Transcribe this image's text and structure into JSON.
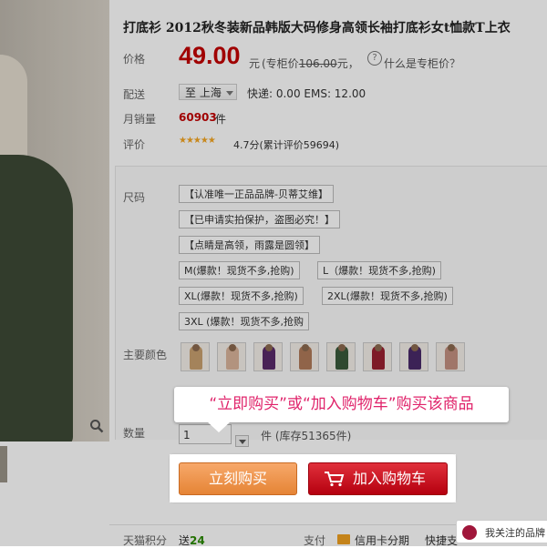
{
  "title": "打底衫 2012秋冬装新品韩版大码修身高领长袖打底衫女t恤款T上衣",
  "price": {
    "label": "价格",
    "value": "49.00",
    "unit": "元",
    "compare_prefix": "(专柜价",
    "compare_value": "106.00",
    "compare_suffix": "元，",
    "help_text": "什么是专柜价？",
    "price_color": "#c40000"
  },
  "shipping": {
    "label": "配送",
    "city": "至 上海",
    "text": "快递: 0.00 EMS: 12.00"
  },
  "sales": {
    "label": "月销量",
    "value": "60903",
    "unit": "件"
  },
  "rating": {
    "label": "评价",
    "stars": "★★★★★",
    "text": "4.7分(累计评价59694)"
  },
  "size": {
    "label": "尺码",
    "options": [
      "【认准唯一正品品牌-贝蒂艾维】",
      "【已申请实拍保护，盗图必究！】",
      "【点睛是高领，雨露是圆领】",
      "M(爆款！现货不多,抢购)",
      "L（爆款！现货不多,抢购)",
      "XL(爆款！现货不多,抢购)",
      "2XL(爆款！现货不多,抢购)",
      "3XL (爆款！现货不多,抢购"
    ]
  },
  "colors": {
    "label": "主要颜色",
    "swatches": [
      {
        "color": "#c8a070",
        "icon": "sweater-thumbnail-icon"
      },
      {
        "color": "#d9b49a",
        "icon": "sweater-thumbnail-icon"
      },
      {
        "color": "#5a2a6a",
        "icon": "sweater-thumbnail-icon"
      },
      {
        "color": "#b07a5a",
        "icon": "sweater-thumbnail-icon"
      },
      {
        "color": "#3a5a3a",
        "icon": "sweater-thumbnail-icon"
      },
      {
        "color": "#9a2030",
        "icon": "sweater-thumbnail-icon"
      },
      {
        "color": "#4a2a6a",
        "icon": "sweater-thumbnail-icon"
      },
      {
        "color": "#c49080",
        "icon": "sweater-thumbnail-icon"
      }
    ]
  },
  "quantity": {
    "label": "数量",
    "value": "1",
    "stock_text": "件 (库存51365件)"
  },
  "buttons": {
    "buy_now": "立刻购买",
    "add_to_cart": "加入购物车"
  },
  "callout": "“立即购买”或“加入购物车”购买该商品",
  "bottom": {
    "points_label": "天猫积分",
    "points_prefix": "送",
    "points_value": "24",
    "pay_label": "支付",
    "pay_value": "信用卡分期",
    "fast_label": "快捷支",
    "follow_text": "我关注的品牌"
  }
}
